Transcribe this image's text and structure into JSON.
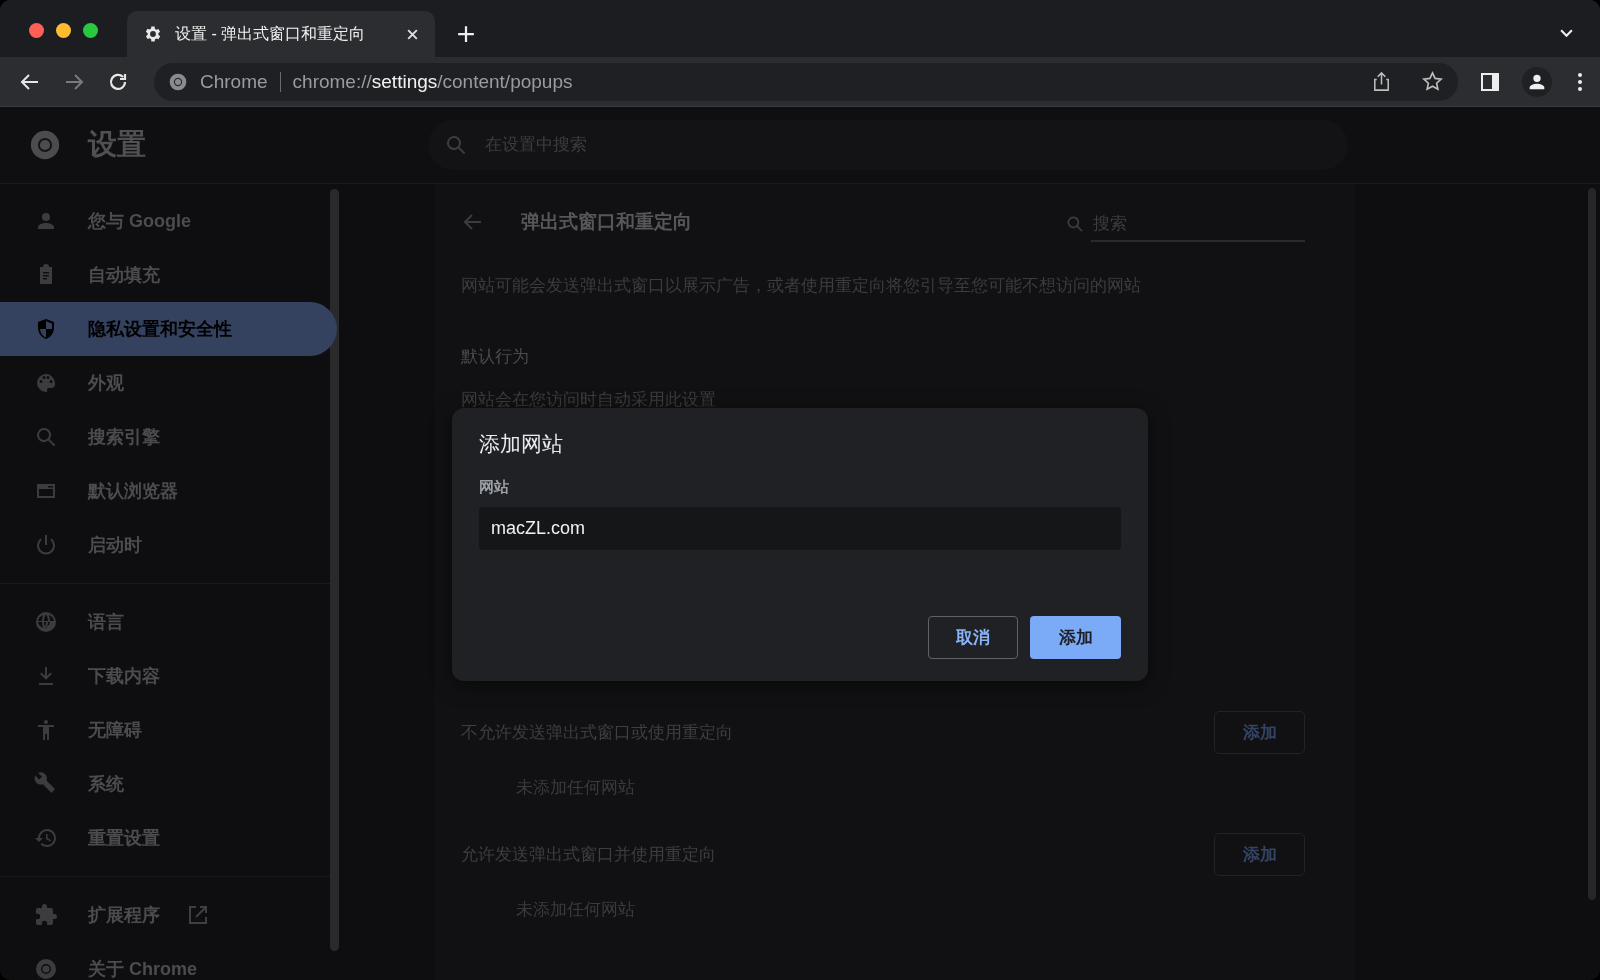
{
  "tabs": [
    {
      "title": "设置 - 弹出式窗口和重定向",
      "selected": true
    }
  ],
  "address_bar": {
    "site_label": "Chrome",
    "url_scheme": "chrome://",
    "url_host": "settings",
    "url_path": "/content/popups"
  },
  "settings_header": {
    "title": "设置",
    "search_placeholder": "在设置中搜索"
  },
  "sidebar": {
    "groups": [
      [
        {
          "label": "您与 Google",
          "selected": false,
          "kind": "page"
        },
        {
          "label": "自动填充",
          "selected": false,
          "kind": "page"
        },
        {
          "label": "隐私设置和安全性",
          "selected": true,
          "kind": "page"
        },
        {
          "label": "外观",
          "selected": false,
          "kind": "page"
        },
        {
          "label": "搜索引擎",
          "selected": false,
          "kind": "page"
        },
        {
          "label": "默认浏览器",
          "selected": false,
          "kind": "page"
        },
        {
          "label": "启动时",
          "selected": false,
          "kind": "page"
        }
      ],
      [
        {
          "label": "语言",
          "selected": false,
          "kind": "page"
        },
        {
          "label": "下载内容",
          "selected": false,
          "kind": "page"
        },
        {
          "label": "无障碍",
          "selected": false,
          "kind": "page"
        },
        {
          "label": "系统",
          "selected": false,
          "kind": "page"
        },
        {
          "label": "重置设置",
          "selected": false,
          "kind": "page"
        }
      ],
      [
        {
          "label": "扩展程序",
          "selected": false,
          "kind": "external"
        },
        {
          "label": "关于 Chrome",
          "selected": false,
          "kind": "page"
        }
      ]
    ]
  },
  "content": {
    "title": "弹出式窗口和重定向",
    "search_placeholder": "搜索",
    "description": "网站可能会发送弹出式窗口以展示广告，或者使用重定向将您引导至您可能不想访问的网站",
    "default_heading": "默认行为",
    "default_note": "网站会在您访问时自动采用此设置",
    "sections": [
      {
        "heading": "不允许发送弹出式窗口或使用重定向",
        "button": "添加",
        "empty": "未添加任何网站"
      },
      {
        "heading": "允许发送弹出式窗口并使用重定向",
        "button": "添加",
        "empty": "未添加任何网站"
      }
    ]
  },
  "dialog": {
    "title": "添加网站",
    "field_label": "网站",
    "field_value": "macZL.com",
    "cancel": "取消",
    "confirm": "添加"
  }
}
